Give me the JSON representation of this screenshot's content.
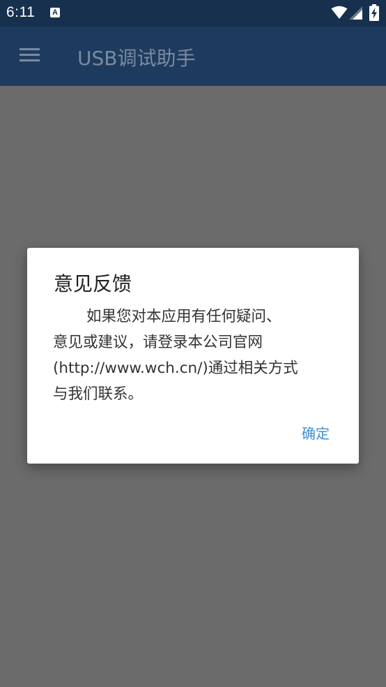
{
  "status_bar": {
    "time": "6:11",
    "notification_icon_letter": "A",
    "icons": [
      "wifi-icon",
      "signal-icon",
      "battery-charging-icon"
    ]
  },
  "app_bar": {
    "title": "USB调试助手",
    "menu_icon": "hamburger-menu-icon"
  },
  "dialog": {
    "title": "意见反馈",
    "message_lines": [
      "如果您对本应用有任何疑问、",
      "意见或建议，请登录本公司官网",
      "(http://www.wch.cn/)通过相关方式",
      "与我们联系。"
    ],
    "confirm_label": "确定"
  },
  "colors": {
    "status_bar": "#16304e",
    "app_bar": "#1d3b5e",
    "scrim": "#6b6b6b",
    "dialog_bg": "#ffffff",
    "accent": "#3d8fd1"
  }
}
